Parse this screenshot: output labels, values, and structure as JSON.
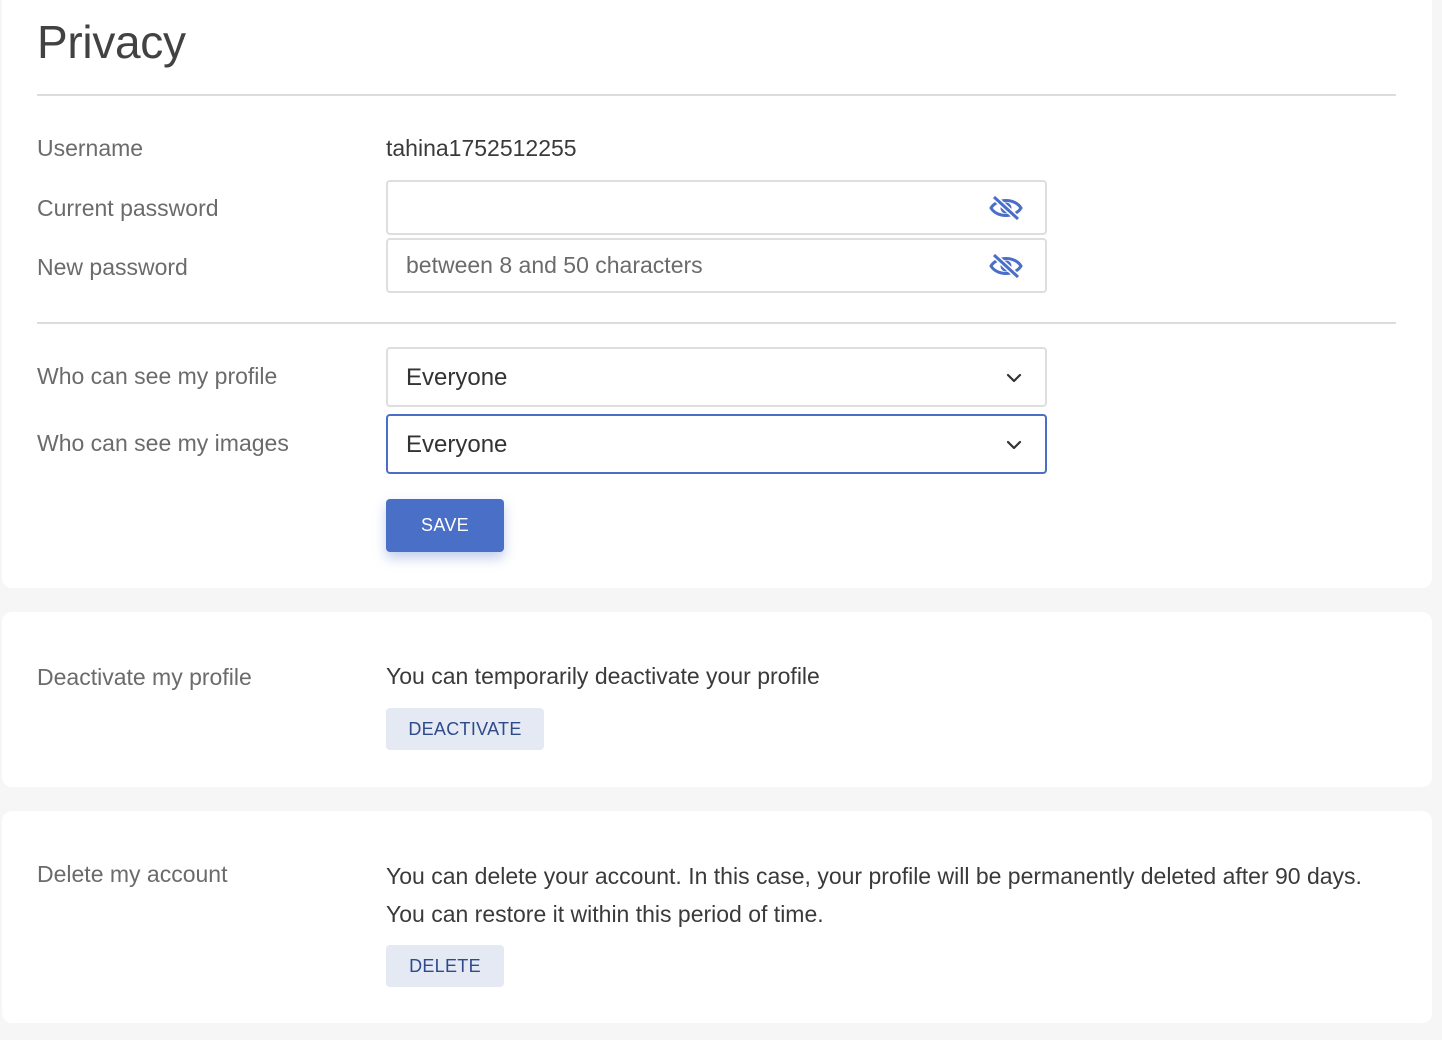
{
  "privacy": {
    "title": "Privacy",
    "username_label": "Username",
    "username_value": "tahina1752512255",
    "current_password_label": "Current password",
    "current_password_value": "",
    "current_password_placeholder": "",
    "new_password_label": "New password",
    "new_password_value": "",
    "new_password_placeholder": "between 8 and 50 characters",
    "profile_visibility_label": "Who can see my profile",
    "profile_visibility_value": "Everyone",
    "images_visibility_label": "Who can see my images",
    "images_visibility_value": "Everyone",
    "save_label": "SAVE",
    "toggle_icon": "eye-slash-icon",
    "dropdown_icon": "chevron-down-icon"
  },
  "deactivate": {
    "label": "Deactivate my profile",
    "description": "You can temporarily deactivate your profile",
    "button_label": "DEACTIVATE"
  },
  "delete": {
    "label": "Delete my account",
    "description": "You can delete your account. In this case, your profile will be permanently deleted after 90 days. You can restore it within this period of time.",
    "button_label": "DELETE"
  },
  "colors": {
    "accent": "#4a6fc6",
    "soft_button_bg": "#e4e9f4",
    "soft_button_text": "#2f4a8a",
    "card_bg": "#ffffff",
    "page_bg": "#f6f6f6"
  }
}
